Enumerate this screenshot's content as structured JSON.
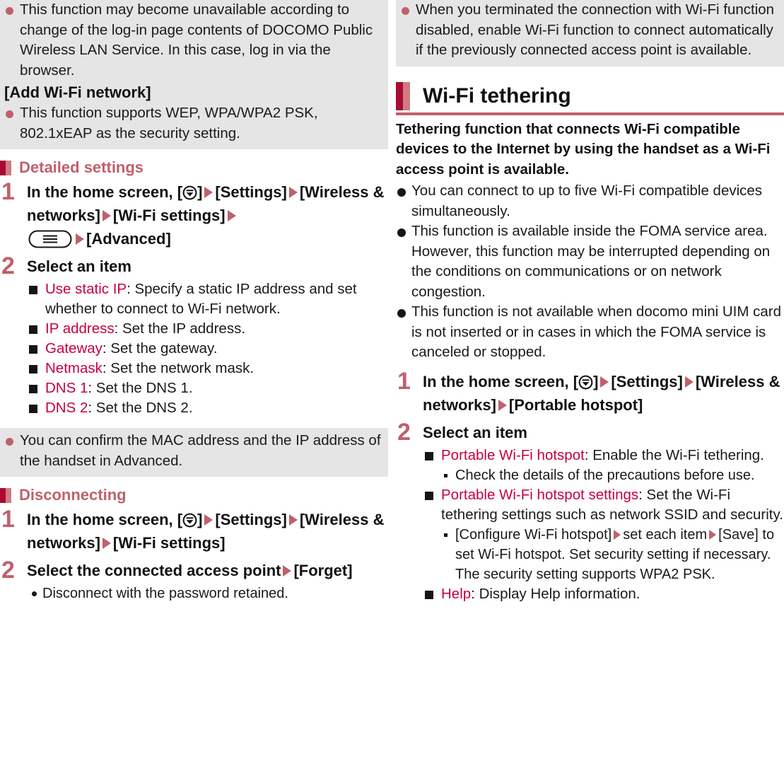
{
  "colors": {
    "accent_rose": "#c1606a",
    "accent_crimson": "#a90b33",
    "term_red": "#c8003c",
    "note_bg": "#e5e5e5",
    "text": "#1a1a1a"
  },
  "left_column": {
    "note_top": {
      "bullets": [
        "This function may become unavailable according to change of the log-in page contents of DOCOMO Public Wireless LAN Service. In this case, log in via the browser."
      ],
      "bracket_heading": "[Add Wi-Fi network]",
      "bullets_after": [
        "This function supports WEP, WPA/WPA2 PSK, 802.1xEAP as the security setting."
      ]
    },
    "section_detailed": {
      "heading": "Detailed settings",
      "steps": [
        {
          "number": "1",
          "title_parts": [
            {
              "type": "text",
              "value": "In the home screen, ["
            },
            {
              "type": "icon",
              "value": "app-drawer-icon"
            },
            {
              "type": "text",
              "value": "]"
            },
            {
              "type": "arrow",
              "value": "arrow-right-icon"
            },
            {
              "type": "text",
              "value": "[Settings]"
            },
            {
              "type": "arrow",
              "value": "arrow-right-icon"
            },
            {
              "type": "text",
              "value": "[Wireless & networks]"
            },
            {
              "type": "arrow",
              "value": "arrow-right-icon"
            },
            {
              "type": "text",
              "value": "[Wi-Fi settings]"
            },
            {
              "type": "arrow",
              "value": "arrow-right-icon"
            },
            {
              "type": "icon",
              "value": "menu-key-icon"
            },
            {
              "type": "arrow",
              "value": "arrow-right-icon"
            },
            {
              "type": "text",
              "value": "[Advanced]"
            }
          ],
          "title_plain_1": "In the home screen, [",
          "title_plain_2": "]",
          "title_plain_3": "[Settings]",
          "title_plain_4": "[Wireless & networks]",
          "title_plain_5": "[Wi-Fi settings]",
          "title_plain_6": "[Advanced]"
        },
        {
          "number": "2",
          "title": "Select an item",
          "items": [
            {
              "term": "Use static IP",
              "desc": ": Specify a static IP address and set whether to connect to Wi-Fi network."
            },
            {
              "term": "IP address",
              "desc": ": Set the IP address."
            },
            {
              "term": "Gateway",
              "desc": ": Set the gateway."
            },
            {
              "term": "Netmask",
              "desc": ": Set the network mask."
            },
            {
              "term": "DNS 1",
              "desc": ": Set the DNS 1."
            },
            {
              "term": "DNS 2",
              "desc": ": Set the DNS 2."
            }
          ]
        }
      ]
    },
    "note_mac": {
      "bullets": [
        "You can confirm the MAC address and the IP address of the handset in Advanced."
      ]
    },
    "section_disconnecting": {
      "heading": "Disconnecting",
      "steps": [
        {
          "number": "1",
          "title_plain_1": "In the home screen, [",
          "title_plain_2": "]",
          "title_plain_3": "[Settings]",
          "title_plain_4": "[Wireless & networks]",
          "title_plain_5": "[Wi-Fi settings]"
        },
        {
          "number": "2",
          "title_plain_1": "Select the connected access point",
          "title_plain_2": "[Forget]",
          "subitems": [
            "Disconnect with the password retained."
          ]
        }
      ]
    }
  },
  "right_column": {
    "note_top": {
      "bullets": [
        "When you terminated the connection with Wi-Fi function disabled, enable Wi-Fi function to connect automatically if the previously connected access point is available."
      ]
    },
    "major_heading": "Wi-Fi tethering",
    "lead": "Tethering function that connects Wi-Fi compatible devices to the Internet by using the handset as a Wi-Fi access point is available.",
    "bullets": [
      "You can connect to up to five Wi-Fi compatible devices simultaneously.",
      "This function is available inside the FOMA service area. However, this function may be interrupted depending on the conditions on communications or on network congestion.",
      "This function is not available when docomo mini UIM card is not inserted or in cases in which the FOMA service is canceled or stopped."
    ],
    "steps": [
      {
        "number": "1",
        "title_plain_1": "In the home screen, [",
        "title_plain_2": "]",
        "title_plain_3": "[Settings]",
        "title_plain_4": "[Wireless & networks]",
        "title_plain_5": "[Portable hotspot]"
      },
      {
        "number": "2",
        "title": "Select an item",
        "items": [
          {
            "term": "Portable Wi-Fi hotspot",
            "desc": ": Enable the Wi-Fi tethering.",
            "subitems": [
              "Check the details of the precautions before use."
            ]
          },
          {
            "term": "Portable Wi-Fi hotspot settings",
            "desc": ": Set the Wi-Fi tethering settings such as network SSID and security.",
            "sub_rich": {
              "p1": "[Configure Wi-Fi hotspot]",
              "p2": "set each item",
              "p3": "[Save] to set Wi-Fi hotspot. Set security setting if necessary. The security setting supports WPA2 PSK."
            }
          },
          {
            "term": "Help",
            "desc": ": Display Help information."
          }
        ]
      }
    ]
  }
}
